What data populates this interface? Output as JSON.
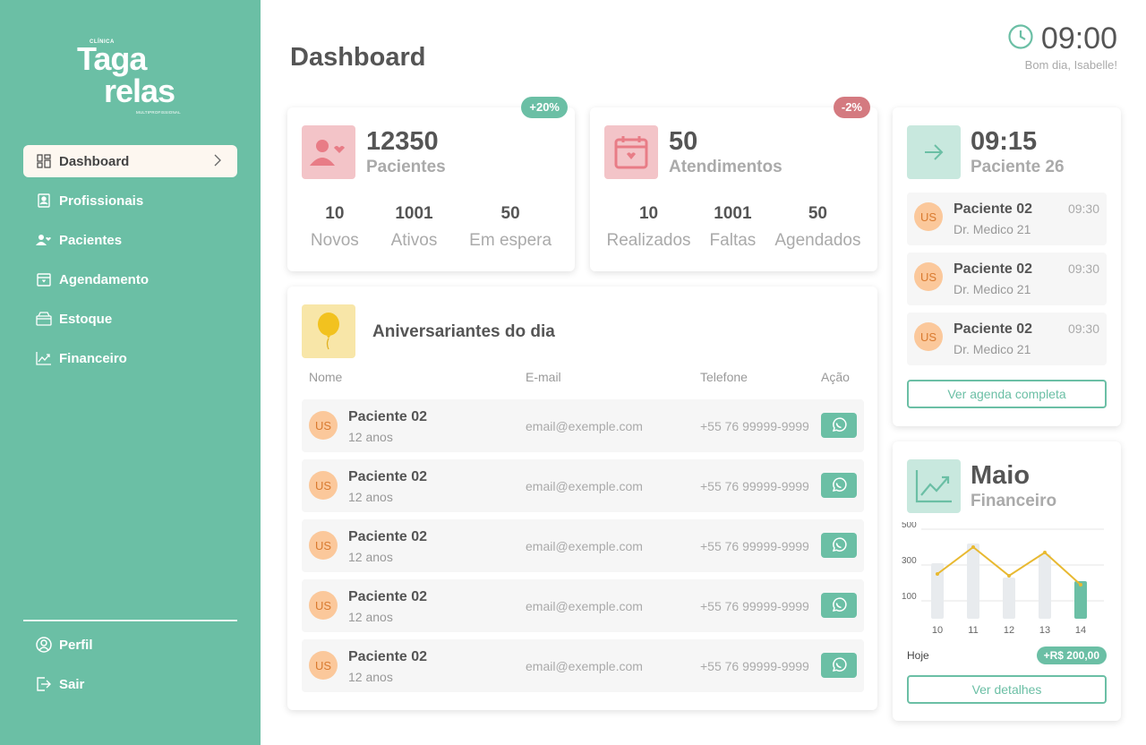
{
  "app": {
    "title": "Dashboard"
  },
  "logo": {
    "small": "CLÍNICA",
    "line1": "Taga",
    "line2": "relas",
    "tiny": "MULTIPROFISSIONAL"
  },
  "sidebar": {
    "items": [
      {
        "label": "Dashboard",
        "icon": "dashboard-icon"
      },
      {
        "label": "Profissionais",
        "icon": "id-badge-icon"
      },
      {
        "label": "Pacientes",
        "icon": "user-heart-icon"
      },
      {
        "label": "Agendamento",
        "icon": "calendar-heart-icon"
      },
      {
        "label": "Estoque",
        "icon": "box-icon"
      },
      {
        "label": "Financeiro",
        "icon": "trend-icon"
      }
    ],
    "bottom": [
      {
        "label": "Perfil",
        "icon": "user-circle-icon"
      },
      {
        "label": "Sair",
        "icon": "logout-icon"
      }
    ]
  },
  "header": {
    "time": "09:00",
    "greeting": "Bom dia, Isabelle!"
  },
  "patients_card": {
    "value": "12350",
    "label": "Pacientes",
    "badge": "+20%",
    "stats": [
      {
        "n": "10",
        "l": "Novos"
      },
      {
        "n": "1001",
        "l": "Ativos"
      },
      {
        "n": "50",
        "l": "Em espera"
      }
    ]
  },
  "appointments_card": {
    "value": "50",
    "label": "Atendimentos",
    "badge": "-2%",
    "stats": [
      {
        "n": "10",
        "l": "Realizados"
      },
      {
        "n": "1001",
        "l": "Faltas"
      },
      {
        "n": "50",
        "l": "Agendados"
      }
    ]
  },
  "birthdays": {
    "title": "Aniversariantes do dia",
    "headers": {
      "name": "Nome",
      "email": "E-mail",
      "phone": "Telefone",
      "action": "Ação"
    },
    "rows": [
      {
        "initials": "US",
        "name": "Paciente 02",
        "age": "12 anos",
        "email": "email@exemple.com",
        "phone": "+55 76 99999-9999"
      },
      {
        "initials": "US",
        "name": "Paciente 02",
        "age": "12 anos",
        "email": "email@exemple.com",
        "phone": "+55 76 99999-9999"
      },
      {
        "initials": "US",
        "name": "Paciente 02",
        "age": "12 anos",
        "email": "email@exemple.com",
        "phone": "+55 76 99999-9999"
      },
      {
        "initials": "US",
        "name": "Paciente 02",
        "age": "12 anos",
        "email": "email@exemple.com",
        "phone": "+55 76 99999-9999"
      },
      {
        "initials": "US",
        "name": "Paciente 02",
        "age": "12 anos",
        "email": "email@exemple.com",
        "phone": "+55 76 99999-9999"
      }
    ]
  },
  "agenda": {
    "next_time": "09:15",
    "next_patient": "Paciente 26",
    "items": [
      {
        "initials": "US",
        "name": "Paciente 02",
        "doctor": "Dr. Medico 21",
        "time": "09:30"
      },
      {
        "initials": "US",
        "name": "Paciente 02",
        "doctor": "Dr. Medico 21",
        "time": "09:30"
      },
      {
        "initials": "US",
        "name": "Paciente 02",
        "doctor": "Dr. Medico 21",
        "time": "09:30"
      }
    ],
    "button": "Ver agenda completa"
  },
  "finance": {
    "month": "Maio",
    "label": "Financeiro",
    "today_label": "Hoje",
    "today_value": "+R$ 200,00",
    "button": "Ver detalhes"
  },
  "colors": {
    "accent": "#6bbfa5",
    "line": "#e8b931",
    "bar": "#e8ebee",
    "negative": "#d47a80"
  },
  "chart_data": {
    "type": "bar",
    "categories": [
      "10",
      "11",
      "12",
      "13",
      "14"
    ],
    "series": [
      {
        "type": "bar",
        "values": [
          310,
          420,
          230,
          360,
          210
        ]
      },
      {
        "type": "line",
        "values": [
          250,
          400,
          240,
          370,
          190
        ]
      }
    ],
    "yticks": [
      "100",
      "300",
      "500"
    ],
    "ylim": [
      0,
      500
    ],
    "highlight_index": 4,
    "grid": true
  }
}
